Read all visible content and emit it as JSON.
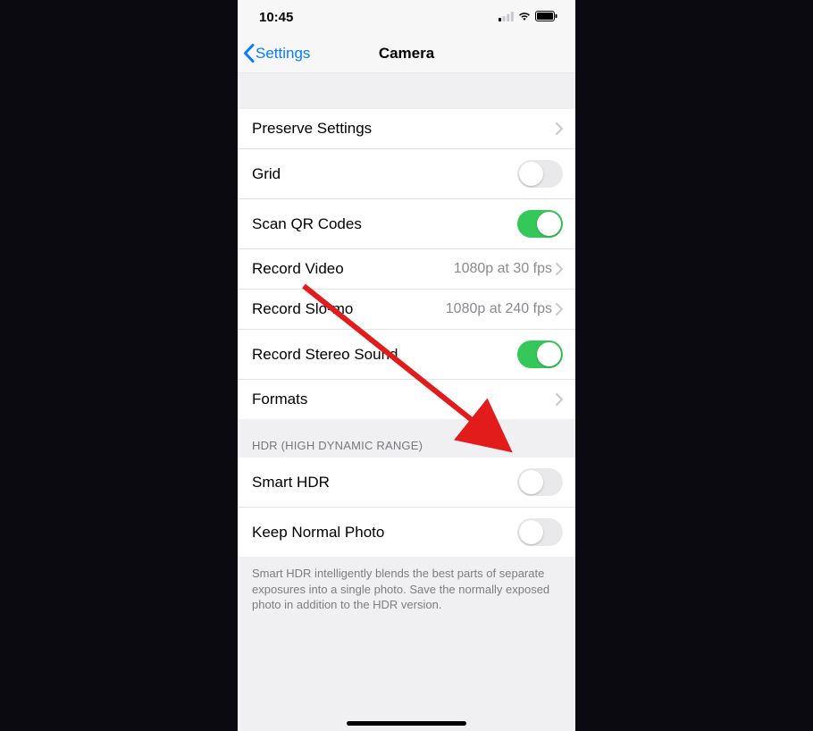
{
  "status": {
    "time": "10:45"
  },
  "nav": {
    "back": "Settings",
    "title": "Camera"
  },
  "rows": {
    "preserve": "Preserve Settings",
    "grid": "Grid",
    "scanqr": "Scan QR Codes",
    "recvideo": "Record Video",
    "recvideo_val": "1080p at 30 fps",
    "recslomo": "Record Slo-mo",
    "recslomo_val": "1080p at 240 fps",
    "recstereo": "Record Stereo Sound",
    "formats": "Formats"
  },
  "section": {
    "hdr_header": "HDR (HIGH DYNAMIC RANGE)",
    "smart_hdr": "Smart HDR",
    "keep_normal": "Keep Normal Photo",
    "hdr_footer": "Smart HDR intelligently blends the best parts of separate exposures into a single photo. Save the normally exposed photo in addition to the HDR version."
  },
  "toggles": {
    "grid": false,
    "scanqr": true,
    "recstereo": true,
    "smart_hdr": false,
    "keep_normal": false
  }
}
